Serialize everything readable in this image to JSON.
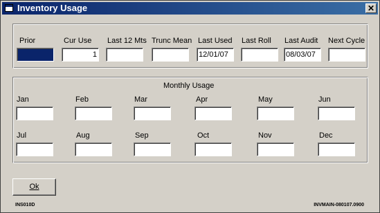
{
  "window": {
    "title": "Inventory Usage",
    "close_glyph": "✕"
  },
  "usage": {
    "fields": [
      {
        "label": "Prior",
        "value": ""
      },
      {
        "label": "Cur Use",
        "value": "1"
      },
      {
        "label": "Last 12 Mts",
        "value": ""
      },
      {
        "label": "Trunc Mean",
        "value": ""
      },
      {
        "label": "Last Used",
        "value": "12/01/07"
      },
      {
        "label": "Last Roll",
        "value": ""
      },
      {
        "label": "Last Audit",
        "value": "08/03/07"
      },
      {
        "label": "Next Cycle",
        "value": ""
      }
    ]
  },
  "monthly": {
    "title": "Monthly Usage",
    "months": [
      {
        "label": "Jan",
        "value": ""
      },
      {
        "label": "Feb",
        "value": ""
      },
      {
        "label": "Mar",
        "value": ""
      },
      {
        "label": "Apr",
        "value": ""
      },
      {
        "label": "May",
        "value": ""
      },
      {
        "label": "Jun",
        "value": ""
      },
      {
        "label": "Jul",
        "value": ""
      },
      {
        "label": "Aug",
        "value": ""
      },
      {
        "label": "Sep",
        "value": ""
      },
      {
        "label": "Oct",
        "value": ""
      },
      {
        "label": "Nov",
        "value": ""
      },
      {
        "label": "Dec",
        "value": ""
      }
    ]
  },
  "buttons": {
    "ok_label": "Ok"
  },
  "footer": {
    "left_code": "INS010D",
    "right_code": "INVMAIN-080107.0900"
  },
  "colors": {
    "titlebar": "#0a246a",
    "face": "#d4d0c8",
    "selection": "#0a246a"
  },
  "icons": {
    "title": "window-icon",
    "close": "close-icon"
  }
}
